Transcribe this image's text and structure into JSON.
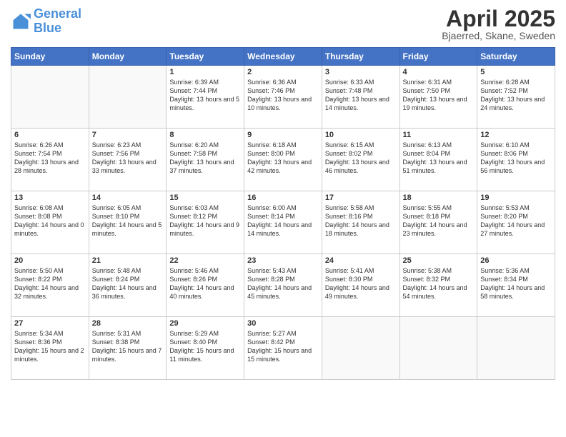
{
  "header": {
    "logo_general": "General",
    "logo_blue": "Blue",
    "title": "April 2025",
    "subtitle": "Bjaerred, Skane, Sweden"
  },
  "calendar": {
    "days_of_week": [
      "Sunday",
      "Monday",
      "Tuesday",
      "Wednesday",
      "Thursday",
      "Friday",
      "Saturday"
    ],
    "weeks": [
      [
        {
          "day": "",
          "info": ""
        },
        {
          "day": "",
          "info": ""
        },
        {
          "day": "1",
          "info": "Sunrise: 6:39 AM\nSunset: 7:44 PM\nDaylight: 13 hours and 5 minutes."
        },
        {
          "day": "2",
          "info": "Sunrise: 6:36 AM\nSunset: 7:46 PM\nDaylight: 13 hours and 10 minutes."
        },
        {
          "day": "3",
          "info": "Sunrise: 6:33 AM\nSunset: 7:48 PM\nDaylight: 13 hours and 14 minutes."
        },
        {
          "day": "4",
          "info": "Sunrise: 6:31 AM\nSunset: 7:50 PM\nDaylight: 13 hours and 19 minutes."
        },
        {
          "day": "5",
          "info": "Sunrise: 6:28 AM\nSunset: 7:52 PM\nDaylight: 13 hours and 24 minutes."
        }
      ],
      [
        {
          "day": "6",
          "info": "Sunrise: 6:26 AM\nSunset: 7:54 PM\nDaylight: 13 hours and 28 minutes."
        },
        {
          "day": "7",
          "info": "Sunrise: 6:23 AM\nSunset: 7:56 PM\nDaylight: 13 hours and 33 minutes."
        },
        {
          "day": "8",
          "info": "Sunrise: 6:20 AM\nSunset: 7:58 PM\nDaylight: 13 hours and 37 minutes."
        },
        {
          "day": "9",
          "info": "Sunrise: 6:18 AM\nSunset: 8:00 PM\nDaylight: 13 hours and 42 minutes."
        },
        {
          "day": "10",
          "info": "Sunrise: 6:15 AM\nSunset: 8:02 PM\nDaylight: 13 hours and 46 minutes."
        },
        {
          "day": "11",
          "info": "Sunrise: 6:13 AM\nSunset: 8:04 PM\nDaylight: 13 hours and 51 minutes."
        },
        {
          "day": "12",
          "info": "Sunrise: 6:10 AM\nSunset: 8:06 PM\nDaylight: 13 hours and 56 minutes."
        }
      ],
      [
        {
          "day": "13",
          "info": "Sunrise: 6:08 AM\nSunset: 8:08 PM\nDaylight: 14 hours and 0 minutes."
        },
        {
          "day": "14",
          "info": "Sunrise: 6:05 AM\nSunset: 8:10 PM\nDaylight: 14 hours and 5 minutes."
        },
        {
          "day": "15",
          "info": "Sunrise: 6:03 AM\nSunset: 8:12 PM\nDaylight: 14 hours and 9 minutes."
        },
        {
          "day": "16",
          "info": "Sunrise: 6:00 AM\nSunset: 8:14 PM\nDaylight: 14 hours and 14 minutes."
        },
        {
          "day": "17",
          "info": "Sunrise: 5:58 AM\nSunset: 8:16 PM\nDaylight: 14 hours and 18 minutes."
        },
        {
          "day": "18",
          "info": "Sunrise: 5:55 AM\nSunset: 8:18 PM\nDaylight: 14 hours and 23 minutes."
        },
        {
          "day": "19",
          "info": "Sunrise: 5:53 AM\nSunset: 8:20 PM\nDaylight: 14 hours and 27 minutes."
        }
      ],
      [
        {
          "day": "20",
          "info": "Sunrise: 5:50 AM\nSunset: 8:22 PM\nDaylight: 14 hours and 32 minutes."
        },
        {
          "day": "21",
          "info": "Sunrise: 5:48 AM\nSunset: 8:24 PM\nDaylight: 14 hours and 36 minutes."
        },
        {
          "day": "22",
          "info": "Sunrise: 5:46 AM\nSunset: 8:26 PM\nDaylight: 14 hours and 40 minutes."
        },
        {
          "day": "23",
          "info": "Sunrise: 5:43 AM\nSunset: 8:28 PM\nDaylight: 14 hours and 45 minutes."
        },
        {
          "day": "24",
          "info": "Sunrise: 5:41 AM\nSunset: 8:30 PM\nDaylight: 14 hours and 49 minutes."
        },
        {
          "day": "25",
          "info": "Sunrise: 5:38 AM\nSunset: 8:32 PM\nDaylight: 14 hours and 54 minutes."
        },
        {
          "day": "26",
          "info": "Sunrise: 5:36 AM\nSunset: 8:34 PM\nDaylight: 14 hours and 58 minutes."
        }
      ],
      [
        {
          "day": "27",
          "info": "Sunrise: 5:34 AM\nSunset: 8:36 PM\nDaylight: 15 hours and 2 minutes."
        },
        {
          "day": "28",
          "info": "Sunrise: 5:31 AM\nSunset: 8:38 PM\nDaylight: 15 hours and 7 minutes."
        },
        {
          "day": "29",
          "info": "Sunrise: 5:29 AM\nSunset: 8:40 PM\nDaylight: 15 hours and 11 minutes."
        },
        {
          "day": "30",
          "info": "Sunrise: 5:27 AM\nSunset: 8:42 PM\nDaylight: 15 hours and 15 minutes."
        },
        {
          "day": "",
          "info": ""
        },
        {
          "day": "",
          "info": ""
        },
        {
          "day": "",
          "info": ""
        }
      ]
    ]
  }
}
